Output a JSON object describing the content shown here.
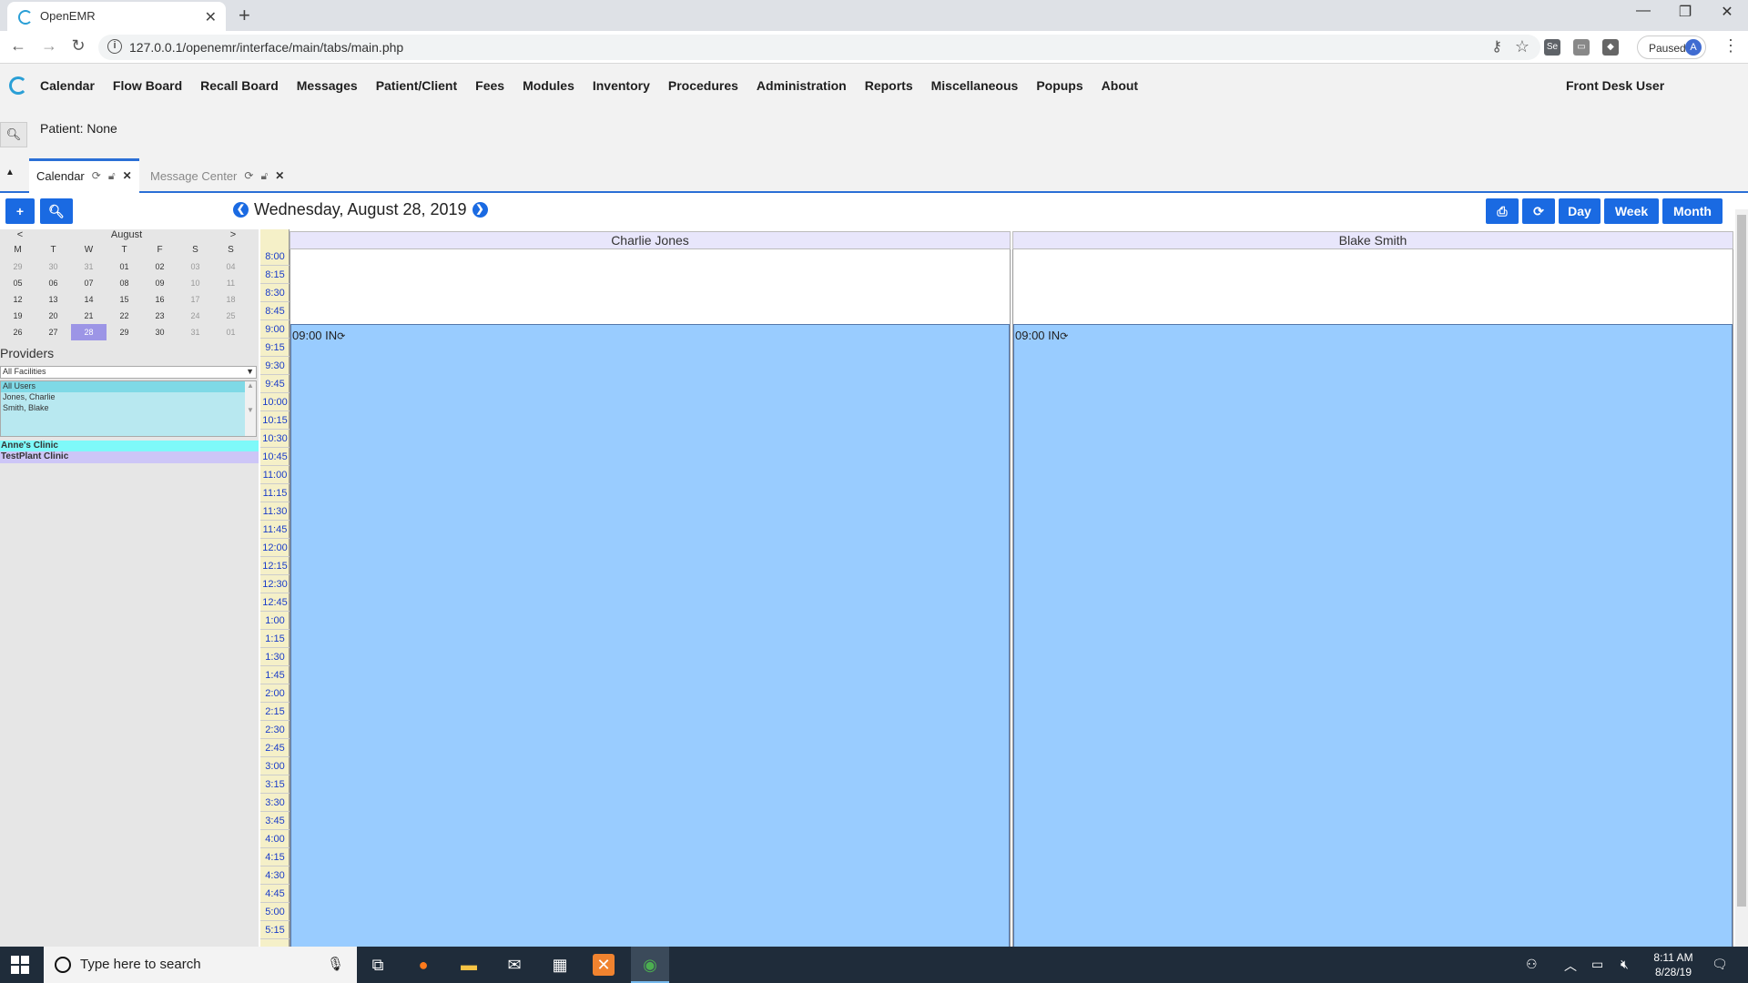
{
  "browser": {
    "tab_title": "OpenEMR",
    "url": "127.0.0.1/openemr/interface/main/tabs/main.php",
    "profile_status": "Paused",
    "profile_initial": "A"
  },
  "app": {
    "menu": [
      "Calendar",
      "Flow Board",
      "Recall Board",
      "Messages",
      "Patient/Client",
      "Fees",
      "Modules",
      "Inventory",
      "Procedures",
      "Administration",
      "Reports",
      "Miscellaneous",
      "Popups",
      "About"
    ],
    "user": "Front Desk User",
    "patient": "Patient: None",
    "tabs": [
      {
        "label": "Calendar",
        "active": true
      },
      {
        "label": "Message Center",
        "active": false
      }
    ]
  },
  "calendar": {
    "date_title": "Wednesday, August 28, 2019",
    "view_buttons": {
      "day": "Day",
      "week": "Week",
      "month": "Month"
    },
    "minical": {
      "prev": "<",
      "month": "August",
      "next": ">",
      "daynames": [
        "M",
        "T",
        "W",
        "T",
        "F",
        "S",
        "S"
      ],
      "weeks": [
        [
          "29",
          "30",
          "31",
          "01",
          "02",
          "03",
          "04"
        ],
        [
          "05",
          "06",
          "07",
          "08",
          "09",
          "10",
          "11"
        ],
        [
          "12",
          "13",
          "14",
          "15",
          "16",
          "17",
          "18"
        ],
        [
          "19",
          "20",
          "21",
          "22",
          "23",
          "24",
          "25"
        ],
        [
          "26",
          "27",
          "28",
          "29",
          "30",
          "31",
          "01"
        ]
      ],
      "selected": "28"
    },
    "providers_label": "Providers",
    "facility_select": "All Facilities",
    "provider_options": [
      "All Users",
      "Jones, Charlie",
      "Smith, Blake"
    ],
    "facilities": [
      {
        "name": "Anne's Clinic",
        "color": "#7ef9f9"
      },
      {
        "name": "TestPlant Clinic",
        "color": "#cdc6f7"
      }
    ],
    "times": [
      "8:00",
      "8:15",
      "8:30",
      "8:45",
      "9:00",
      "9:15",
      "9:30",
      "9:45",
      "10:00",
      "10:15",
      "10:30",
      "10:45",
      "11:00",
      "11:15",
      "11:30",
      "11:45",
      "12:00",
      "12:15",
      "12:30",
      "12:45",
      "1:00",
      "1:15",
      "1:30",
      "1:45",
      "2:00",
      "2:15",
      "2:30",
      "2:45",
      "3:00",
      "3:15",
      "3:30",
      "3:45",
      "4:00",
      "4:15",
      "4:30",
      "4:45",
      "5:00",
      "5:15"
    ],
    "providers": [
      {
        "name": "Charlie Jones",
        "event": "09:00 IN"
      },
      {
        "name": "Blake Smith",
        "event": "09:00 IN"
      }
    ],
    "event_color": "#99ccff"
  },
  "taskbar": {
    "search_placeholder": "Type here to search",
    "time": "8:11 AM",
    "date": "8/28/19"
  }
}
